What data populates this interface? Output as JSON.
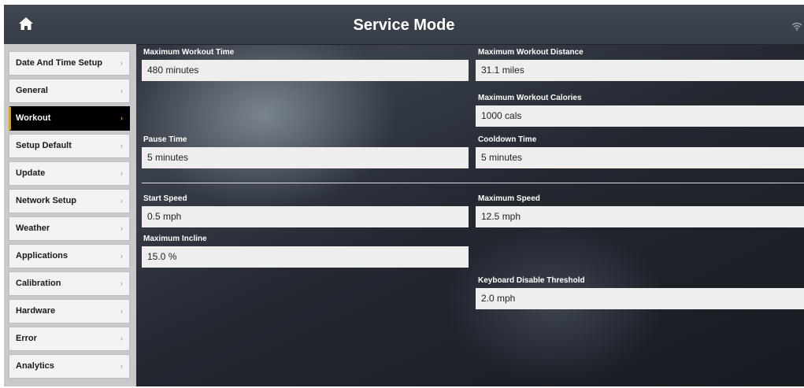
{
  "header": {
    "title": "Service Mode",
    "home_icon": "home-icon",
    "wifi_icon": "wifi-icon"
  },
  "sidebar": {
    "items": [
      {
        "label": "Date And Time Setup",
        "active": false
      },
      {
        "label": "General",
        "active": false
      },
      {
        "label": "Workout",
        "active": true
      },
      {
        "label": "Setup Default",
        "active": false
      },
      {
        "label": "Update",
        "active": false
      },
      {
        "label": "Network Setup",
        "active": false
      },
      {
        "label": "Weather",
        "active": false
      },
      {
        "label": "Applications",
        "active": false
      },
      {
        "label": "Calibration",
        "active": false
      },
      {
        "label": "Hardware",
        "active": false
      },
      {
        "label": "Error",
        "active": false
      },
      {
        "label": "Analytics",
        "active": false
      }
    ],
    "chevron": "›",
    "accent_color": "#e0a21b"
  },
  "fields": {
    "max_workout_time": {
      "label": "Maximum Workout Time",
      "value": "480 minutes"
    },
    "max_workout_distance": {
      "label": "Maximum Workout Distance",
      "value": "31.1 miles"
    },
    "max_workout_calories": {
      "label": "Maximum Workout Calories",
      "value": "1000 cals"
    },
    "pause_time": {
      "label": "Pause Time",
      "value": "5 minutes"
    },
    "cooldown_time": {
      "label": "Cooldown Time",
      "value": "5 minutes"
    },
    "start_speed": {
      "label": "Start Speed",
      "value": "0.5 mph"
    },
    "max_speed": {
      "label": "Maximum Speed",
      "value": "12.5 mph"
    },
    "max_incline": {
      "label": "Maximum Incline",
      "value": "15.0 %"
    },
    "keyboard_disable_threshold": {
      "label": "Keyboard Disable Threshold",
      "value": "2.0 mph"
    }
  }
}
